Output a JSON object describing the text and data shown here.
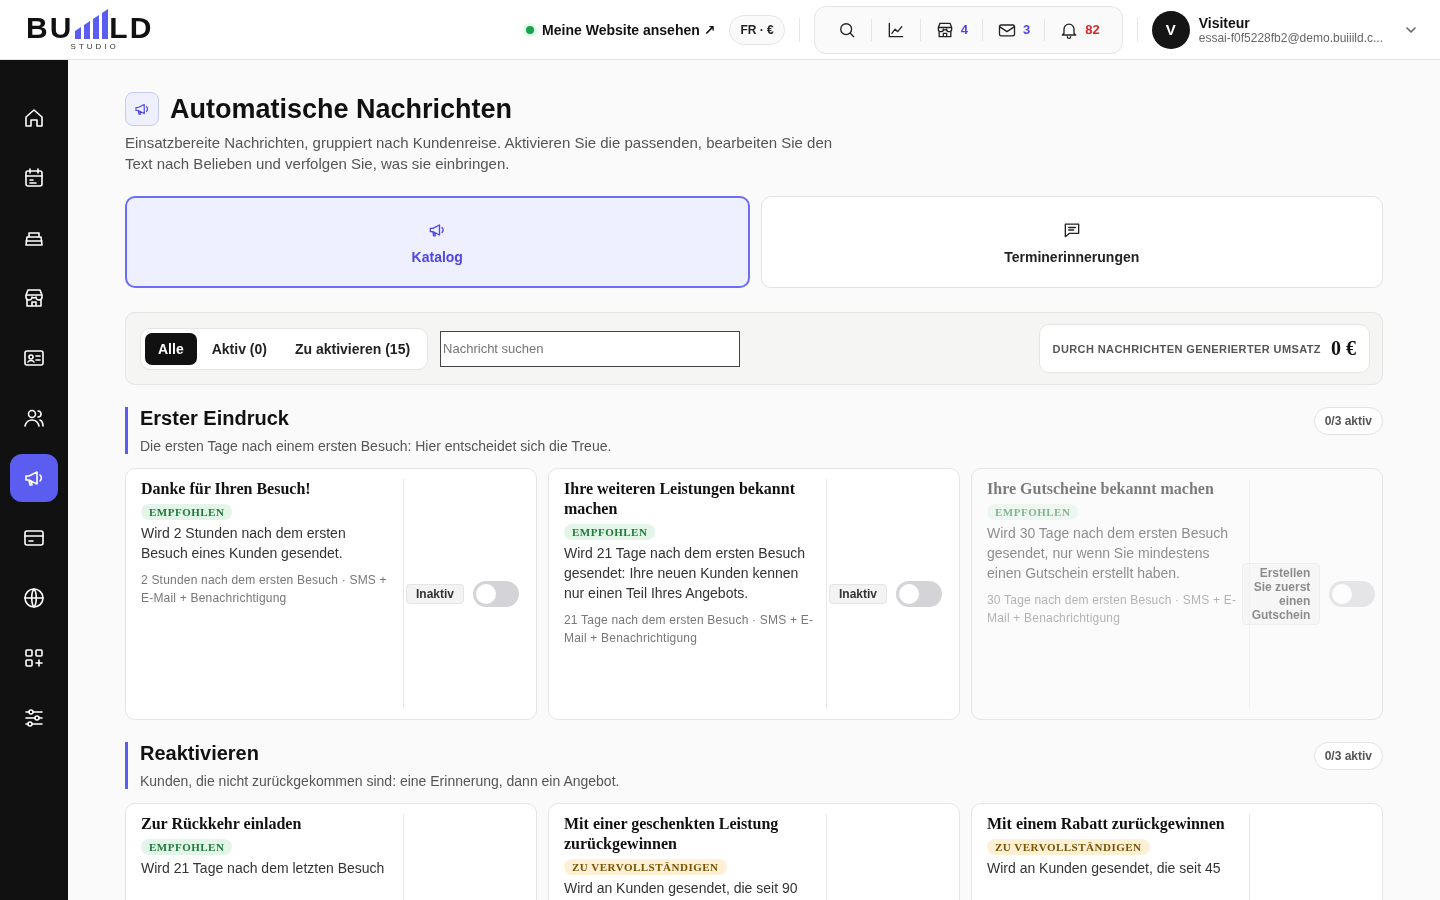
{
  "header": {
    "logo": {
      "left": "BU",
      "right": "LD",
      "sub": "STUDIO"
    },
    "site_link": {
      "label": "Meine Website ansehen ↗",
      "online": true
    },
    "locale": "FR · €",
    "toolbar": [
      {
        "kind": "search"
      },
      {
        "kind": "chart"
      },
      {
        "kind": "store",
        "count": "4",
        "color": "#4f46e5"
      },
      {
        "kind": "mail",
        "count": "3",
        "color": "#4f46e5"
      },
      {
        "kind": "bell",
        "count": "82",
        "color": "#dc2626"
      }
    ],
    "user": {
      "initial": "V",
      "name": "Visiteur",
      "email": "essai-f0f5228fb2@demo.buiiild.c..."
    }
  },
  "sidebar": {
    "items": [
      {
        "kind": "home",
        "selected": false
      },
      {
        "kind": "calendar",
        "selected": false
      },
      {
        "kind": "register",
        "selected": false
      },
      {
        "kind": "store",
        "selected": false
      },
      {
        "kind": "card",
        "selected": false
      },
      {
        "kind": "users",
        "selected": false
      },
      {
        "kind": "megaphone",
        "selected": true
      },
      {
        "kind": "payment",
        "selected": false
      },
      {
        "kind": "globe",
        "selected": false
      },
      {
        "kind": "apps",
        "selected": false
      },
      {
        "kind": "sliders",
        "selected": false
      }
    ]
  },
  "page": {
    "title": "Automatische Nachrichten",
    "subtitle": "Einsatzbereite Nachrichten, gruppiert nach Kundenreise. Aktivieren Sie die passenden, bearbeiten Sie den Text nach Belieben und verfolgen Sie, was sie einbringen."
  },
  "tabs": [
    {
      "label": "Katalog",
      "kind": "megaphone",
      "selected": true
    },
    {
      "label": "Terminerinnerungen",
      "kind": "chat",
      "selected": false
    }
  ],
  "filters": [
    {
      "label": "Alle",
      "selected": true
    },
    {
      "label": "Aktiv (0)",
      "selected": false
    },
    {
      "label": "Zu aktivieren (15)",
      "selected": false
    }
  ],
  "search": {
    "placeholder": "Nachricht suchen"
  },
  "revenue": {
    "label": "DURCH NACHRICHTEN GENERIERTER UMSATZ",
    "value": "0 €"
  },
  "sections": [
    {
      "title": "Erster Eindruck",
      "subtitle": "Die ersten Tage nach einem ersten Besuch: Hier entscheidet sich die Treue.",
      "count": "0/3 aktiv",
      "cards": [
        {
          "title": "Danke für Ihren Besuch!",
          "badge": {
            "kind": "recommended",
            "label": "EMPFOHLEN"
          },
          "description": "Wird 2 Stunden nach dem ersten Besuch eines Kunden gesendet.",
          "meta": "2 Stunden nach dem ersten Besuch · SMS + E-Mail + Benachrichtigung",
          "status": "Inaktiv",
          "on": false,
          "disabled": false
        },
        {
          "title": "Ihre weiteren Leistungen bekannt machen",
          "badge": {
            "kind": "recommended",
            "label": "EMPFOHLEN"
          },
          "description": "Wird 21 Tage nach dem ersten Besuch gesendet: Ihre neuen Kunden kennen nur einen Teil Ihres Angebots.",
          "meta": "21 Tage nach dem ersten Besuch · SMS + E-Mail + Benachrichtigung",
          "status": "Inaktiv",
          "on": false,
          "disabled": false
        },
        {
          "title": "Ihre Gutscheine bekannt machen",
          "badge": {
            "kind": "recommended",
            "label": "EMPFOHLEN"
          },
          "description": "Wird 30 Tage nach dem ersten Besuch gesendet, nur wenn Sie mindestens einen Gutschein erstellt haben.",
          "meta": "30 Tage nach dem ersten Besuch · SMS + E-Mail + Benachrichtigung",
          "status": "Erstellen Sie zuerst einen Gutschein",
          "on": false,
          "disabled": true
        }
      ]
    },
    {
      "title": "Reaktivieren",
      "subtitle": "Kunden, die nicht zurückgekommen sind: eine Erinnerung, dann ein Angebot.",
      "count": "0/3 aktiv",
      "cards": [
        {
          "title": "Zur Rückkehr einladen",
          "badge": {
            "kind": "recommended",
            "label": "EMPFOHLEN"
          },
          "description": "Wird 21 Tage nach dem letzten Besuch",
          "disabled": false
        },
        {
          "title": "Mit einer geschenkten Leistung zurückgewinnen",
          "badge": {
            "kind": "todo",
            "label": "ZU VERVOLLSTÄNDIGEN"
          },
          "description": "Wird an Kunden gesendet, die seit 90",
          "disabled": false
        },
        {
          "title": "Mit einem Rabatt zurückgewinnen",
          "badge": {
            "kind": "todo",
            "label": "ZU VERVOLLSTÄNDIGEN"
          },
          "description": "Wird an Kunden gesendet, die seit 45",
          "disabled": false
        }
      ]
    }
  ]
}
